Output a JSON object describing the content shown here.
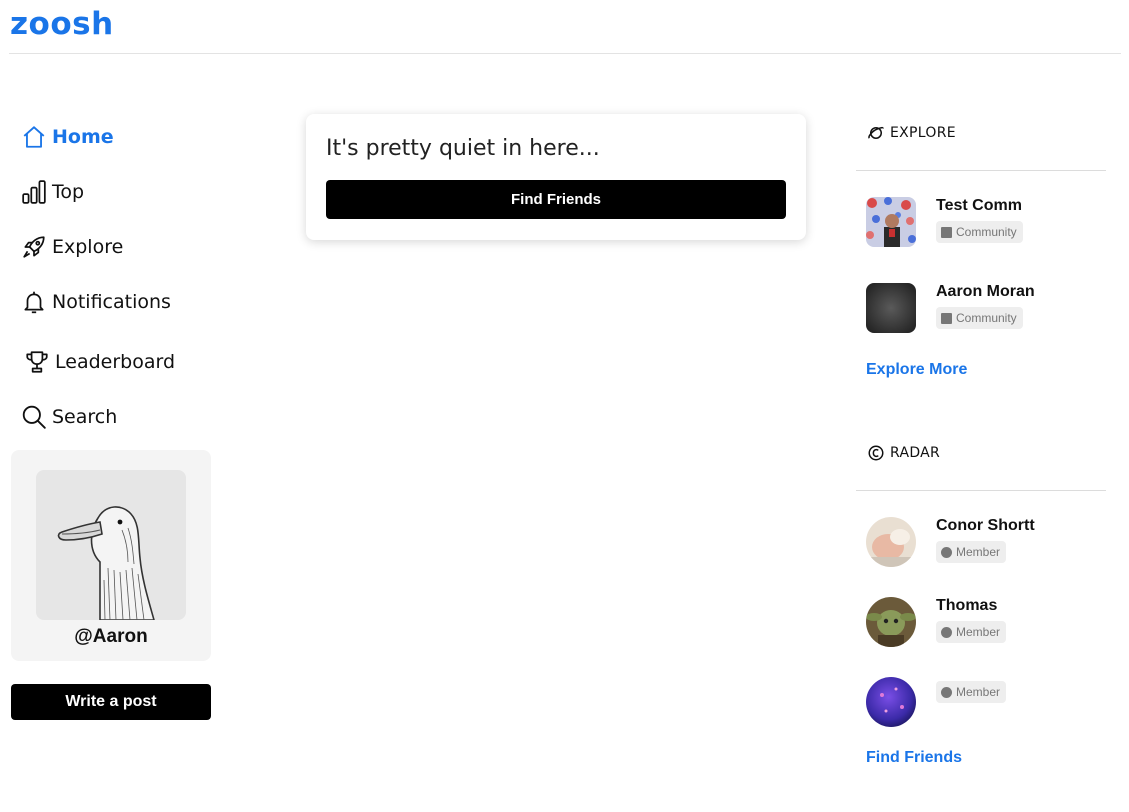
{
  "brand": {
    "logo_text": "zoosh",
    "accent_color": "#1a75e8"
  },
  "nav": {
    "items": [
      {
        "label": "Home",
        "icon": "home-icon",
        "active": true
      },
      {
        "label": "Top",
        "icon": "bar-chart-icon",
        "active": false
      },
      {
        "label": "Explore",
        "icon": "rocket-icon",
        "active": false
      },
      {
        "label": "Notifications",
        "icon": "bell-icon",
        "active": false
      },
      {
        "label": "Leaderboard",
        "icon": "trophy-icon",
        "active": false
      },
      {
        "label": "Search",
        "icon": "search-icon",
        "active": false
      }
    ]
  },
  "profile": {
    "handle": "@Aaron",
    "avatar": "goose-avatar"
  },
  "actions": {
    "write_post": "Write a post"
  },
  "feed": {
    "empty_message": "It's pretty quiet in here...",
    "find_friends_button": "Find Friends"
  },
  "explore": {
    "heading": "EXPLORE",
    "icon": "planet-icon",
    "items": [
      {
        "name": "Test Comm",
        "badge": "Community",
        "avatar": "collage-avatar"
      },
      {
        "name": "Aaron Moran",
        "badge": "Community",
        "avatar": "dark-gradient-avatar"
      }
    ],
    "more_link": "Explore More"
  },
  "radar": {
    "heading": "RADAR",
    "icon": "radar-icon",
    "items": [
      {
        "name": "Conor Shortt",
        "badge": "Member",
        "avatar": "photo-avatar"
      },
      {
        "name": "Thomas",
        "badge": "Member",
        "avatar": "yoda-avatar"
      },
      {
        "name": "",
        "badge": "Member",
        "avatar": "purple-orb-avatar"
      }
    ],
    "more_link": "Find Friends"
  }
}
